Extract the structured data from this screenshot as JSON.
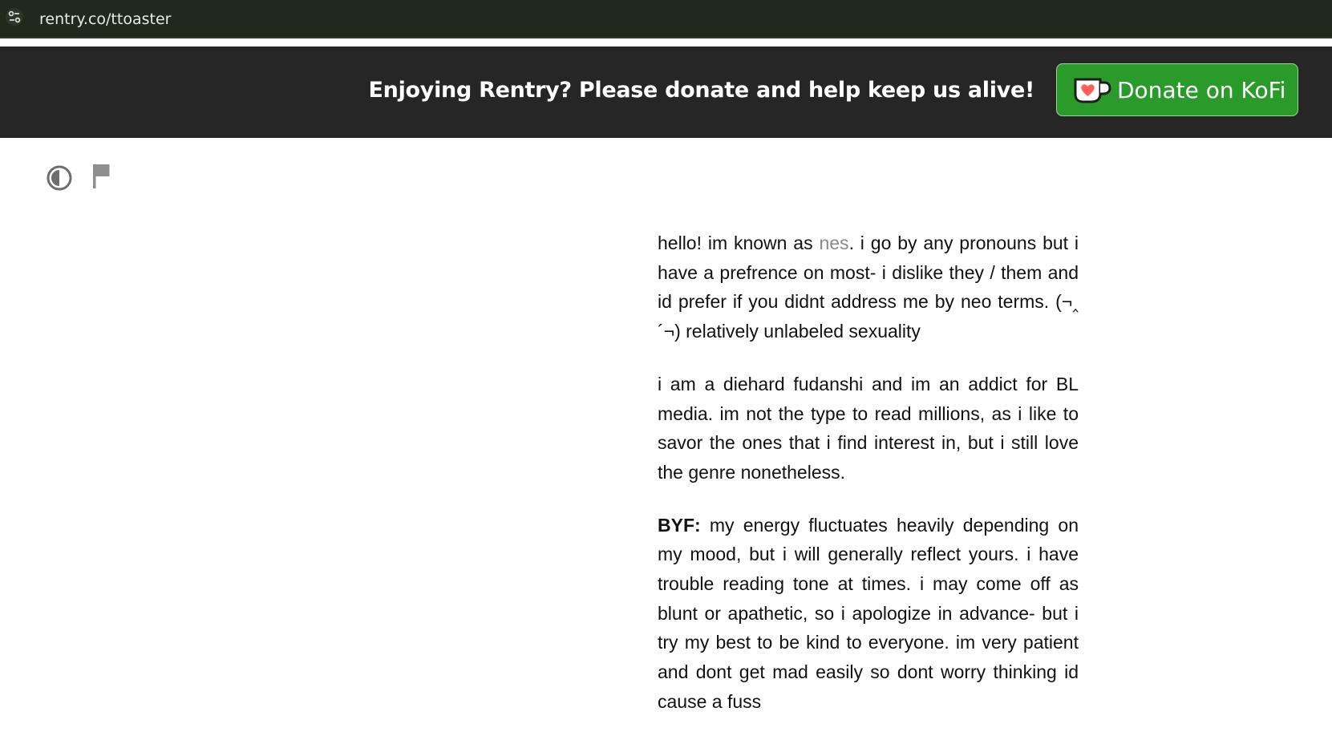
{
  "browser": {
    "url": "rentry.co/ttoaster",
    "site_info_icon": "tune-icon"
  },
  "banner": {
    "message": "Enjoying Rentry? Please donate and help keep us alive!",
    "donate_label": "Donate on KoFi",
    "donate_icon": "kofi-cup-icon",
    "colors": {
      "background": "#262626",
      "button": "#2a9b2b",
      "cup_heart": "#ff5e5b"
    }
  },
  "toolbar": {
    "theme_icon": "half-circle-icon",
    "flag_icon": "flag-icon"
  },
  "article": {
    "p1_before": "hello! im known as ",
    "p1_name": "nes",
    "p1_after": ". i go by any pronouns but i have a prefrence on most- i dislike they / them and id prefer if you didnt address me by neo terms. (¬‸´¬) relatively unlabeled sexuality",
    "p2": "i am a diehard fudanshi and im an addict for BL media. im not the type to read millions, as i like to savor the ones that i find interest in, but i still love the genre nonetheless.",
    "p3_label": "BYF:",
    "p3_text": " my energy fluctuates heavily depending on my mood, but i will generally reflect yours. i have trouble reading tone at times. i may come off as blunt or apathetic, so i apologize in advance- but i try my best to be kind to everyone. im very patient and dont get mad easily so dont worry thinking id cause a fuss"
  }
}
